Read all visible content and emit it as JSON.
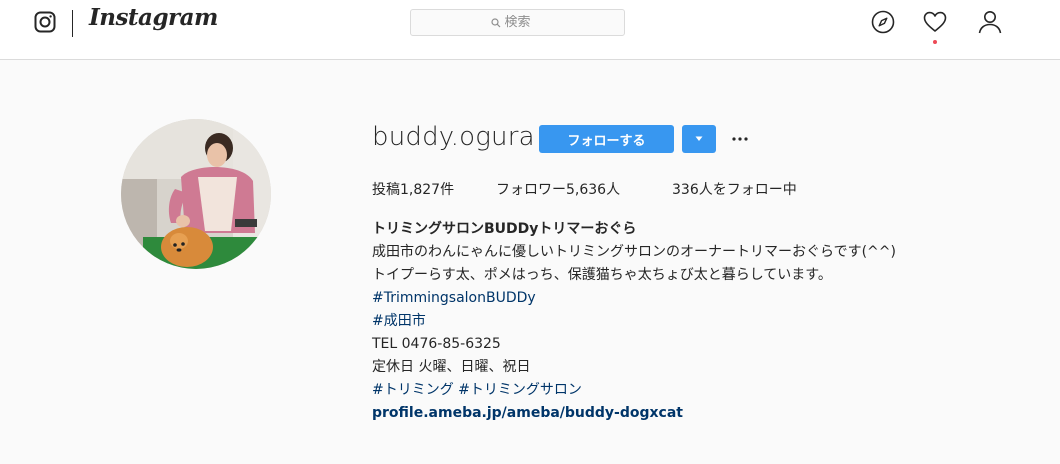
{
  "header": {
    "brand": "Instagram",
    "search": {
      "placeholder": "検索"
    },
    "icons": [
      "instagram-glyph-icon",
      "search-icon",
      "compass-icon",
      "heart-icon",
      "profile-icon"
    ],
    "notification_dot": true
  },
  "profile": {
    "username": "buddy.ogura",
    "follow_button": "フォローする",
    "stats": [
      {
        "label": "投稿",
        "value": "1,827件"
      },
      {
        "label": "フォロワー",
        "value": "5,636人"
      },
      {
        "label": "",
        "value": "336人をフォロー中"
      }
    ],
    "full_name": "トリミングサロンBUDDyトリマーおぐら",
    "bio_lines": [
      "成田市のわんにゃんに優しいトリミングサロンのオーナートリマーおぐらです(^^)",
      "トイプーらす太、ポメはっち、保護猫ちゃ太ちょび太と暮らしています。"
    ],
    "hashtag_1": "#TrimmingsalonBUDDy",
    "hashtag_2": "#成田市",
    "phone": "TEL 0476-85-6325",
    "hours": "定休日 火曜、日曜、祝日",
    "hashtag_3": "#トリミング #トリミングサロン",
    "website": "profile.ameba.jp/ameba/buddy-dogxcat"
  },
  "colors": {
    "accent": "#3897f0",
    "link": "#003569",
    "text": "#262626",
    "muted": "#8e8e8e",
    "background": "#fafafa",
    "notification": "#ed4956"
  }
}
